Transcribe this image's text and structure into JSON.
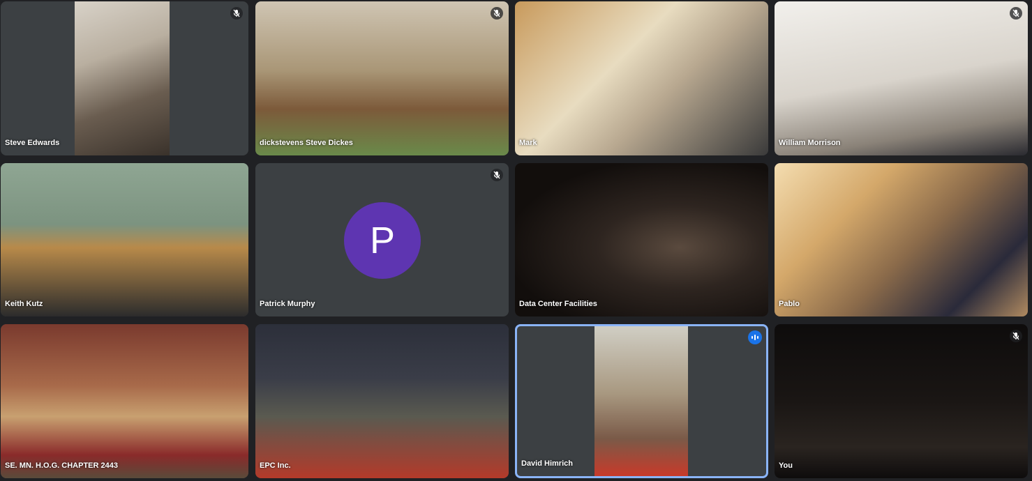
{
  "meeting": {
    "participants": [
      {
        "name": "Steve Edwards",
        "muted": true
      },
      {
        "name": "dickstevens Steve Dickes",
        "muted": true
      },
      {
        "name": "Mark",
        "muted": false
      },
      {
        "name": "William Morrison",
        "muted": true
      },
      {
        "name": "Keith Kutz",
        "muted": false
      },
      {
        "name": "Patrick Murphy",
        "muted": true,
        "avatar_letter": "P"
      },
      {
        "name": "Data Center Facilities",
        "muted": false
      },
      {
        "name": "Pablo",
        "muted": false
      },
      {
        "name": "SE. MN. H.O.G. CHAPTER 2443",
        "muted": false
      },
      {
        "name": "EPC Inc.",
        "muted": false
      },
      {
        "name": "David Himrich",
        "muted": false,
        "speaking": true
      },
      {
        "name": "You",
        "muted": true
      }
    ]
  },
  "colors": {
    "background": "#202124",
    "tile": "#3c4043",
    "speaking_border": "#8ab4f8",
    "avatar": "#5e35b1",
    "speaking_icon": "#1a73e8"
  },
  "icons": {
    "muted": "microphone-off-icon",
    "speaking": "audio-level-icon"
  }
}
